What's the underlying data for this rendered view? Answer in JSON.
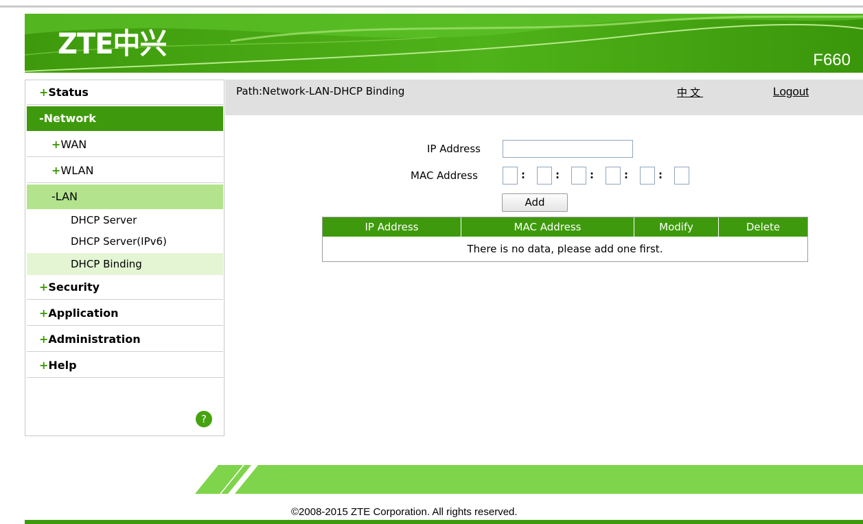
{
  "header": {
    "logo": "ZTE中兴",
    "model": "F660"
  },
  "sidebar": {
    "items": [
      {
        "prefix": "+",
        "label": "Status"
      },
      {
        "prefix": "-",
        "label": "Network"
      },
      {
        "prefix": "+",
        "label": "WAN"
      },
      {
        "prefix": "+",
        "label": "WLAN"
      },
      {
        "prefix": "-",
        "label": "LAN"
      },
      {
        "prefix": "",
        "label": "DHCP Server"
      },
      {
        "prefix": "",
        "label": "DHCP Server(IPv6)"
      },
      {
        "prefix": "",
        "label": "DHCP Binding"
      },
      {
        "prefix": "+",
        "label": "Security"
      },
      {
        "prefix": "+",
        "label": "Application"
      },
      {
        "prefix": "+",
        "label": "Administration"
      },
      {
        "prefix": "+",
        "label": "Help"
      }
    ],
    "help_icon": "?"
  },
  "pathbar": {
    "path": "Path:Network-LAN-DHCP Binding",
    "lang": "中文",
    "logout": "Logout"
  },
  "form": {
    "ip_label": "IP Address",
    "mac_label": "MAC Address",
    "ip_value": "",
    "mac_separator": ":",
    "add_label": "Add"
  },
  "table": {
    "headers": [
      "IP Address",
      "MAC Address",
      "Modify",
      "Delete"
    ],
    "empty_message": "There is no data, please add one first."
  },
  "footer": {
    "copyright": "©2008-2015 ZTE Corporation. All rights reserved."
  },
  "colors": {
    "brand_green": "#3e9a0c",
    "light_green": "#b4e38d",
    "footer_green": "#7ed44a"
  }
}
